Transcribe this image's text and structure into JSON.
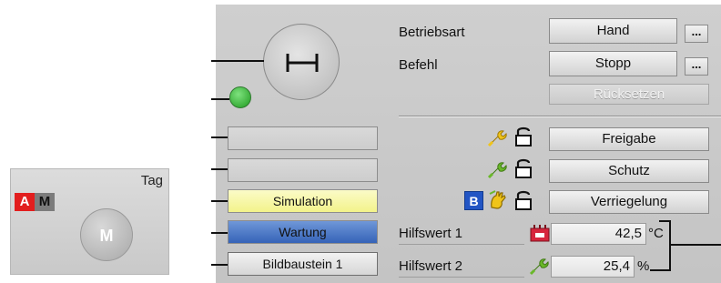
{
  "block_icon": {
    "tag": "Tag",
    "badge_a": "A",
    "badge_m": "M",
    "motor_label": "M",
    "colors": {
      "badge_a": "#e21e1e",
      "badge_m": "#7c7c7c"
    }
  },
  "faceplate": {
    "operating_mode": {
      "label": "Betriebsart",
      "button": "Hand",
      "more": "..."
    },
    "command": {
      "label": "Befehl",
      "button": "Stopp",
      "more": "..."
    },
    "reset_button": "Rücksetzen",
    "status_fields": {
      "simulation": "Simulation",
      "maintenance": "Wartung",
      "faceplate_button": "Bildbaustein 1"
    },
    "interlocks": {
      "release": "Freigabe",
      "protection": "Schutz",
      "interlock": "Verriegelung",
      "bypass_badge": "B"
    },
    "aux_values": [
      {
        "label": "Hilfswert 1",
        "value": "42,5",
        "unit": "°C",
        "icon": "heater-icon"
      },
      {
        "label": "Hilfswert 2",
        "value": "25,4",
        "unit": "%",
        "icon": "wrench-icon"
      }
    ],
    "led_status": "running",
    "colors": {
      "led": "#2faa2f",
      "simulation": "#f3f38a",
      "maintenance": "#3563b8",
      "bypass": "#2255c4"
    }
  }
}
